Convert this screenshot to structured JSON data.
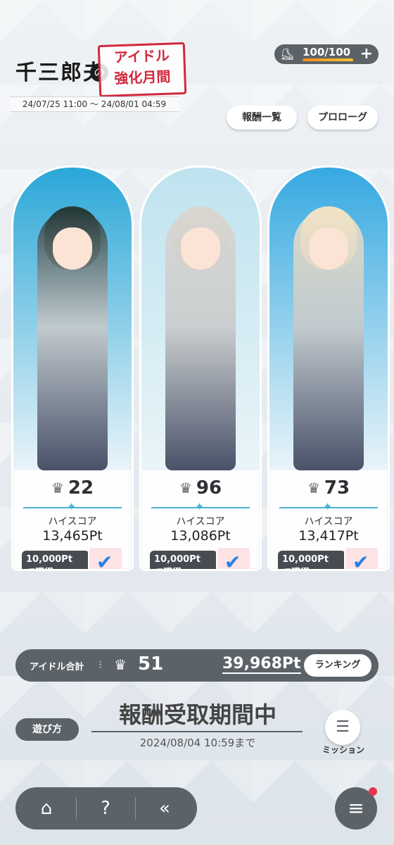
{
  "header": {
    "logo_text": "千三郎夫",
    "logo_connector": "の",
    "stamp_line1": "アイドル",
    "stamp_line2": "強化月間",
    "period": "24/07/25 11:00 ～ 24/08/01 04:59"
  },
  "stamina": {
    "value": "100/100",
    "fraction": 1.0,
    "icon": "boot-icon"
  },
  "buttons": {
    "rewards_list": "報酬一覧",
    "prologue": "プロローグ"
  },
  "idols": [
    {
      "rank": "22",
      "highscore_label": "ハイスコア",
      "score": "13,465Pt",
      "reward_line1": "10,000Pt",
      "reward_line2": "で獲得",
      "hair": "#263a3a",
      "bg": "#2ba7d8"
    },
    {
      "rank": "96",
      "highscore_label": "ハイスコア",
      "score": "13,086Pt",
      "reward_line1": "10,000Pt",
      "reward_line2": "で獲得",
      "hair": "#d9d6d0",
      "bg": "#bfe3ef"
    },
    {
      "rank": "73",
      "highscore_label": "ハイスコア",
      "score": "13,417Pt",
      "reward_line1": "10,000Pt",
      "reward_line2": "で獲得",
      "hair": "#efe2c6",
      "bg": "#36a9e1"
    }
  ],
  "total": {
    "label": "アイドル合計",
    "rank": "51",
    "points": "39,968Pt",
    "ranking_button": "ランキング"
  },
  "status": {
    "main": "報酬受取期間中",
    "until": "2024/08/04 10:59まで"
  },
  "howto": "遊び方",
  "mission": "ミッション",
  "colors": {
    "panel": "#5b6268",
    "accent": "#48b3d6",
    "check": "#2b7fe0",
    "notification": "#e9334c"
  }
}
